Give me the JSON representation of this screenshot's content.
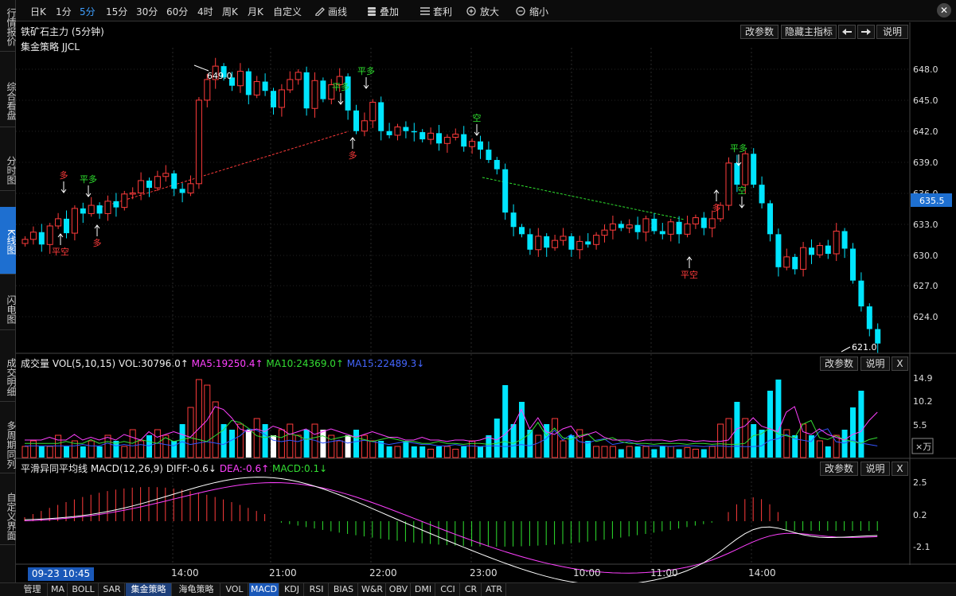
{
  "sidebar": {
    "tabs": [
      "行情报价",
      "综合看盘",
      "分时图",
      "K线图",
      "闪电图",
      "成交明细",
      "多周期同列",
      "自定义界面"
    ],
    "active": "K线图"
  },
  "toolbar": {
    "periods": [
      "日K",
      "1分",
      "5分",
      "15分",
      "30分",
      "60分",
      "4时",
      "周K",
      "月K",
      "自定义"
    ],
    "active_period": "5分",
    "tools": [
      "画线",
      "叠加",
      "套利",
      "放大",
      "缩小"
    ]
  },
  "chart": {
    "title": "铁矿石主力 (5分钟)",
    "strategy": "集金策略 JJCL",
    "buttons": [
      "改参数",
      "隐藏主指标",
      "说明"
    ],
    "y_ticks": [
      "648.0",
      "645.0",
      "642.0",
      "639.0",
      "636.0",
      "633.0",
      "630.0",
      "627.0",
      "624.0"
    ],
    "price_tag": "635.5",
    "high_label": "649.0",
    "low_label": "621.0"
  },
  "volume": {
    "title": "成交量",
    "params": "VOL(5,10,15)",
    "vol": "VOL:30796.0↑",
    "ma5": "MA5:19250.4↑",
    "ma10": "MA10:24369.0↑",
    "ma15": "MA15:22489.3↓",
    "y_ticks": [
      "14.9",
      "10.2",
      "5.5"
    ],
    "unit": "×万",
    "buttons": [
      "改参数",
      "说明",
      "X"
    ]
  },
  "macd": {
    "title": "平滑异同平均线",
    "params": "MACD(12,26,9)",
    "diff": "DIFF:-0.6↓",
    "dea": "DEA:-0.6↑",
    "macd": "MACD:0.1↓",
    "y_ticks": [
      "2.5",
      "0.2",
      "-2.1"
    ],
    "buttons": [
      "改参数",
      "说明",
      "X"
    ]
  },
  "time_axis": {
    "current": "09-23 10:45",
    "labels": [
      "14:00",
      "21:00",
      "22:00",
      "23:00",
      "10:00",
      "11:00",
      "14:00"
    ]
  },
  "bottom_tabs": [
    "管理",
    "MA",
    "BOLL",
    "SAR",
    "集金策略",
    "海龟策略",
    "VOL",
    "MACD",
    "KDJ",
    "RSI",
    "BIAS",
    "W&R",
    "OBV",
    "DMI",
    "CCI",
    "CR",
    "ATR"
  ],
  "bottom_active": "MACD",
  "signals": [
    {
      "text": "平空",
      "color": "#ff3b3b"
    },
    {
      "text": "多",
      "color": "#ff3b3b"
    },
    {
      "text": "平多",
      "color": "#2ee02e"
    },
    {
      "text": "多",
      "color": "#ff3b3b"
    },
    {
      "text": "平多",
      "color": "#2ee02e"
    },
    {
      "text": "平多",
      "color": "#2ee02e"
    },
    {
      "text": "多",
      "color": "#ff3b3b"
    },
    {
      "text": "空",
      "color": "#2ee02e"
    },
    {
      "text": "平空",
      "color": "#ff3b3b"
    },
    {
      "text": "多",
      "color": "#ff3b3b"
    },
    {
      "text": "平多",
      "color": "#2ee02e"
    },
    {
      "text": "空",
      "color": "#2ee02e"
    }
  ],
  "colors": {
    "up": "#ff3b3b",
    "down": "#00e5ff",
    "ma5": "#ffffff",
    "ma10": "#ff40ff",
    "ma15": "#33dd33",
    "ma15b": "#3355ff",
    "accent": "#1e6fd0"
  }
}
